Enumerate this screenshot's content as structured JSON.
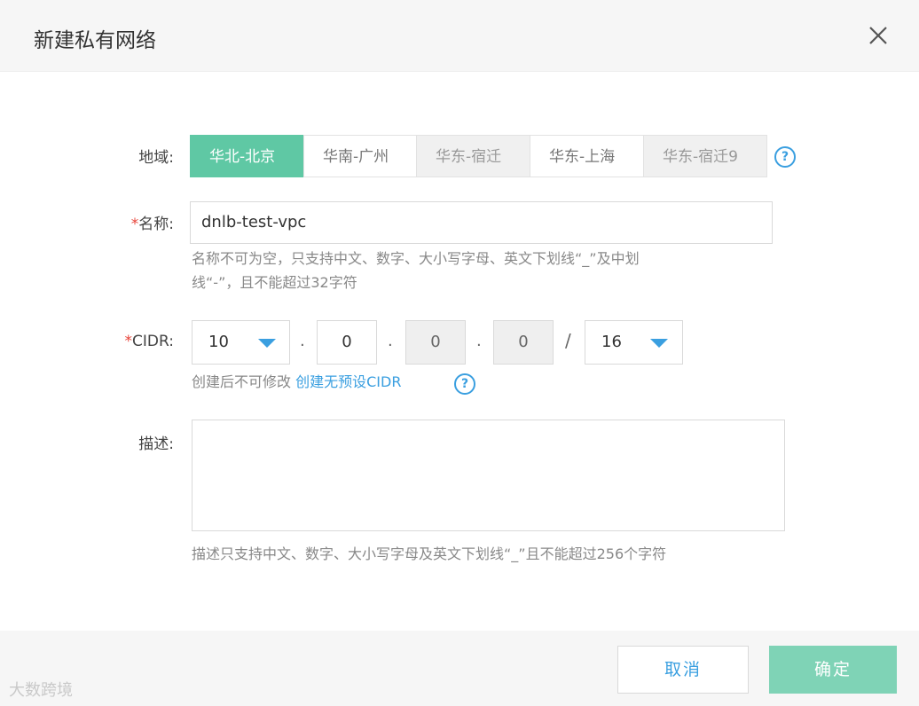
{
  "dialog": {
    "title": "新建私有网络",
    "close_icon": "close-icon"
  },
  "region": {
    "label": "地域:",
    "options": [
      "华北-北京",
      "华南-广州",
      "华东-宿迁",
      "华东-上海",
      "华东-宿迁9"
    ],
    "selected": "华北-北京",
    "help_icon": "question-circle-icon"
  },
  "name": {
    "required_mark": "*",
    "label": "名称:",
    "value": "dnlb-test-vpc",
    "hint_line1": "名称不可为空，只支持中文、数字、大小写字母、英文下划线“_”及中划",
    "hint_line2": "线“-”，且不能超过32字符"
  },
  "cidr": {
    "required_mark": "*",
    "label": "CIDR:",
    "octet1": "10",
    "octet2": "0",
    "octet3": "0",
    "octet4": "0",
    "separator_dot": ".",
    "slash": "/",
    "mask": "16",
    "hint_text": "创建后不可修改",
    "hint_link": "创建无预设CIDR",
    "help_icon": "question-circle-icon"
  },
  "description": {
    "label": "描述:",
    "value": "",
    "hint": "描述只支持中文、数字、大小写字母及英文下划线“_”且不能超过256个字符"
  },
  "footer": {
    "cancel_label": "取消",
    "ok_label": "确定"
  },
  "watermark": "大数跨境",
  "colors": {
    "accent_green": "#5fc8a4",
    "link_blue": "#3a9fe0",
    "required_red": "#e8443a"
  }
}
